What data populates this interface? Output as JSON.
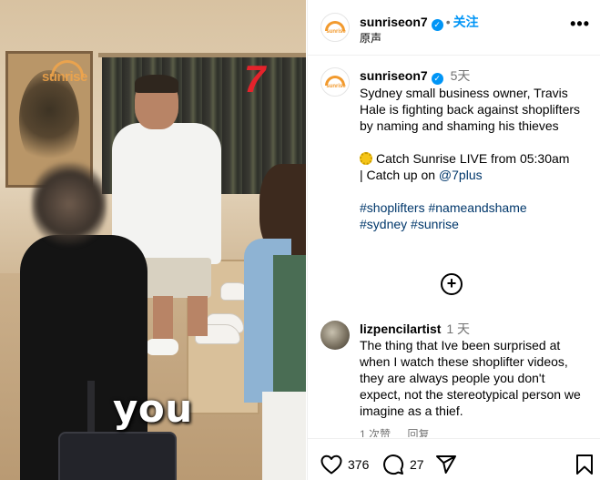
{
  "video": {
    "caption_word": "you",
    "channel_logo_text": "sunrise",
    "network_logo_text": "7"
  },
  "header": {
    "username": "sunriseon7",
    "verified": true,
    "separator": "•",
    "follow_label": "关注",
    "audio_label": "原声",
    "more_label": "•••"
  },
  "post": {
    "username": "sunriseon7",
    "time_ago": "5天",
    "caption": "Sydney small business owner, Travis Hale is fighting back against shoplifters by naming and shaming his thieves",
    "live_line": "Catch Sunrise LIVE from 05:30am",
    "catchup_prefix": "| Catch up on ",
    "catchup_link": "@7plus",
    "hashtags_line1": "#shoplifters #nameandshame",
    "hashtags_line2": "#sydney #sunrise",
    "load_more_label": "+"
  },
  "comments": [
    {
      "username": "lizpencilartist",
      "time_ago": "1 天",
      "text": "The thing that Ive been surprised at when I watch these shoplifter videos, they are always people you don't expect, not the stereotypical person we imagine as a thief.",
      "likes_label": "1 次赞",
      "reply_label": "回复"
    }
  ],
  "actions": {
    "likes_count": "376",
    "comments_count": "27"
  },
  "icons": {
    "header_avatar": "sunrise-logo-avatar",
    "verified": "verified-badge-icon",
    "more": "more-options-icon",
    "live": "sun-icon",
    "load_more": "plus-circle-icon",
    "like": "heart-icon",
    "comment": "comment-bubble-icon",
    "share": "paper-plane-icon",
    "save": "bookmark-icon"
  },
  "colors": {
    "accent_blue": "#0095f6",
    "link_navy": "#00376b",
    "muted_text": "#737373",
    "sunrise_orange": "#f29a2e",
    "seven_red": "#e5232b"
  }
}
